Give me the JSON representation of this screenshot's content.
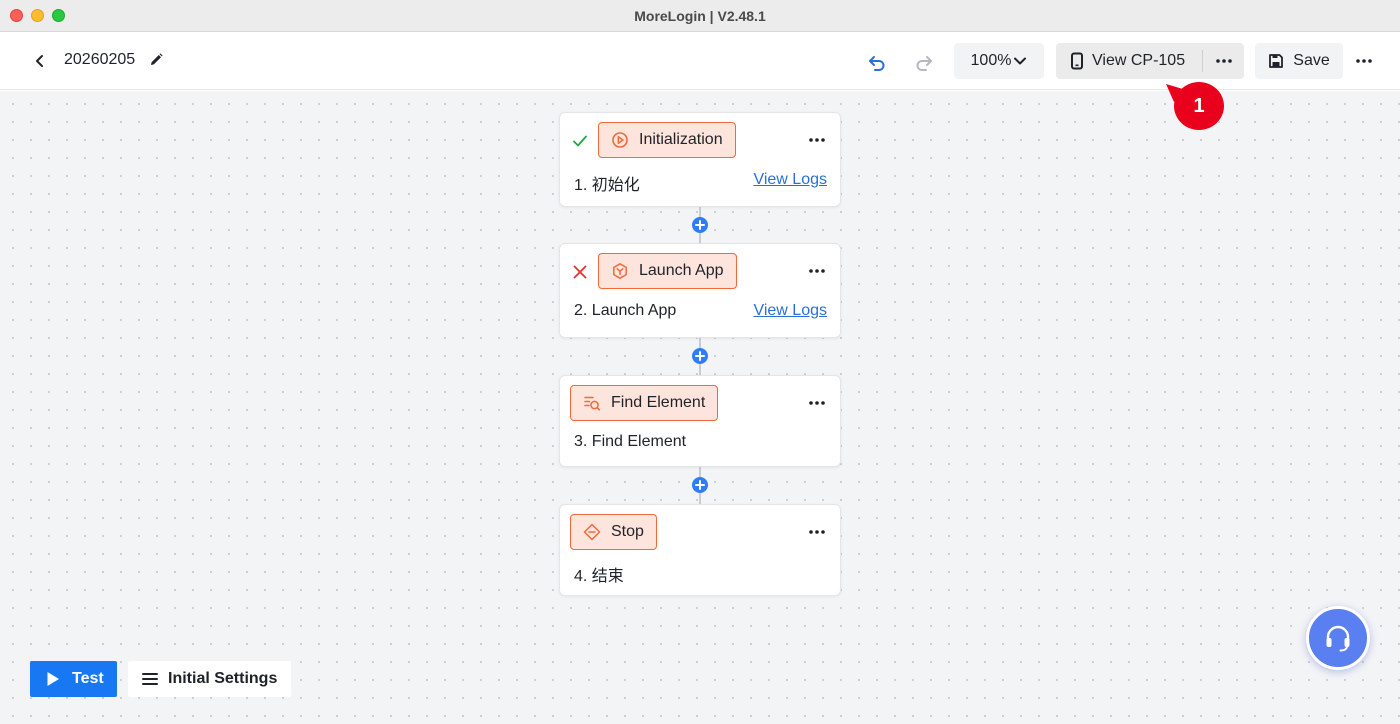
{
  "window": {
    "title": "MoreLogin | V2.48.1"
  },
  "header": {
    "doc_title": "20260205",
    "zoom": "100%",
    "view_device_label": "View CP-105",
    "save_label": "Save"
  },
  "nodes": [
    {
      "tag": "Initialization",
      "label": "1. 初始化",
      "status": "success",
      "logs": "View Logs",
      "icon": "play-circle-icon"
    },
    {
      "tag": "Launch App",
      "label": "2. Launch App",
      "status": "failed",
      "logs": "View Logs",
      "icon": "cube-icon"
    },
    {
      "tag": "Find Element",
      "label": "3. Find Element",
      "status": "none",
      "icon": "list-search-icon"
    },
    {
      "tag": "Stop",
      "label": "4. 结束",
      "status": "none",
      "icon": "end-icon"
    }
  ],
  "callout": {
    "number": "1"
  },
  "bottom": {
    "test_label": "Test",
    "initial_settings_label": "Initial Settings"
  },
  "colors": {
    "accent": "#1877f2",
    "tag_border": "#f06a3b",
    "tag_fill": "#fde4dc",
    "success": "#22a845",
    "error": "#e5322d",
    "callout": "#e8001c",
    "support": "#5a7ff0"
  }
}
